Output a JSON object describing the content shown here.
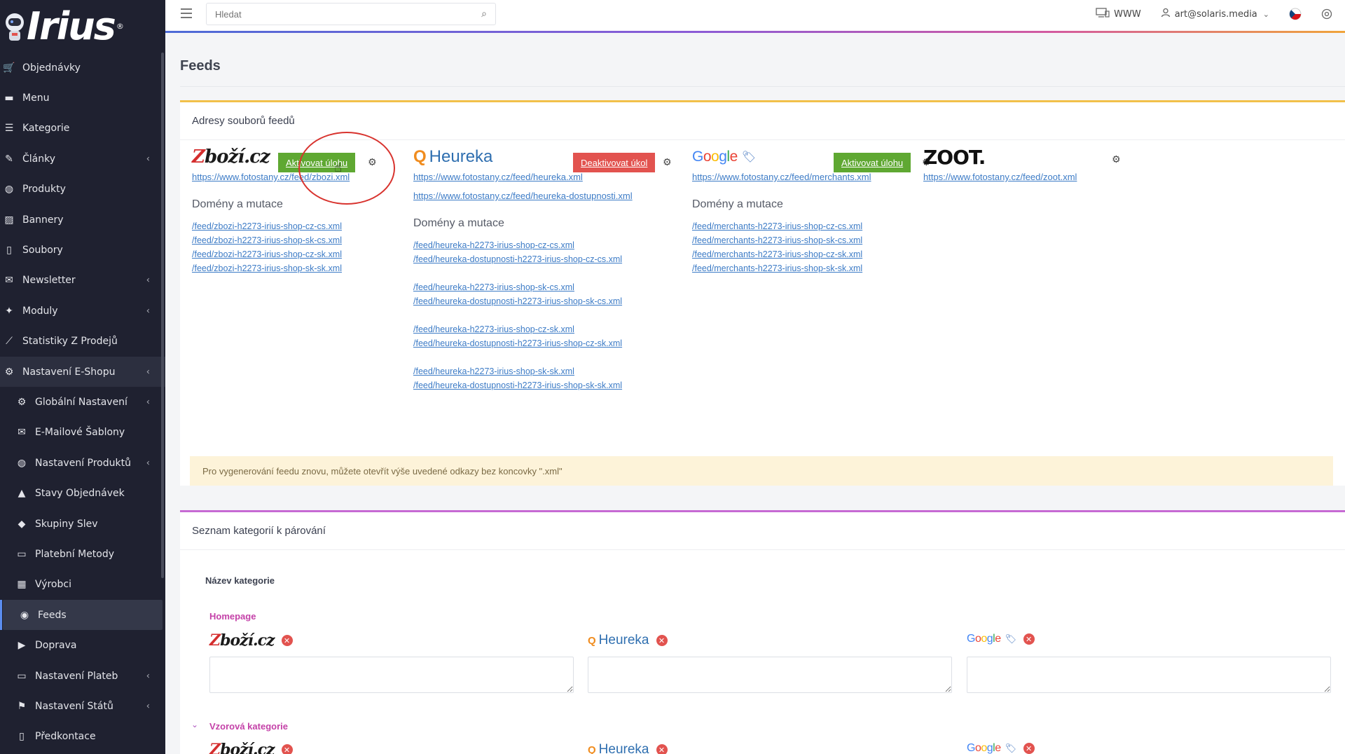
{
  "app": {
    "logo_text": "Irius",
    "logo_reg": "®"
  },
  "sidebar": {
    "items": [
      {
        "label": "Objednávky",
        "icon": "cart-icon",
        "chevron": ""
      },
      {
        "label": "Menu",
        "icon": "folder-icon",
        "chevron": ""
      },
      {
        "label": "Kategorie",
        "icon": "list-icon",
        "chevron": ""
      },
      {
        "label": "Články",
        "icon": "pencil-icon",
        "chevron": "‹"
      },
      {
        "label": "Produkty",
        "icon": "dribbble-icon",
        "chevron": ""
      },
      {
        "label": "Bannery",
        "icon": "image-icon",
        "chevron": ""
      },
      {
        "label": "Soubory",
        "icon": "file-icon",
        "chevron": ""
      },
      {
        "label": "Newsletter",
        "icon": "mail-icon",
        "chevron": "‹"
      },
      {
        "label": "Moduly",
        "icon": "puzzle-icon",
        "chevron": "‹"
      },
      {
        "label": "Statistiky Z Prodejů",
        "icon": "chart-icon",
        "chevron": ""
      },
      {
        "label": "Nastavení E-Shopu",
        "icon": "cogs-icon",
        "chevron": "‹"
      }
    ],
    "sub_items": [
      {
        "label": "Globální Nastavení",
        "icon": "gear-icon",
        "chevron": "‹"
      },
      {
        "label": "E-Mailové Šablony",
        "icon": "envelope-icon",
        "chevron": ""
      },
      {
        "label": "Nastavení Produktů",
        "icon": "dribbble-icon",
        "chevron": "‹"
      },
      {
        "label": "Stavy Objednávek",
        "icon": "bell-icon",
        "chevron": ""
      },
      {
        "label": "Skupiny Slev",
        "icon": "tag-icon",
        "chevron": ""
      },
      {
        "label": "Platební Metody",
        "icon": "credit-card-icon",
        "chevron": ""
      },
      {
        "label": "Výrobci",
        "icon": "building-icon",
        "chevron": ""
      },
      {
        "label": "Feeds",
        "icon": "rss-icon",
        "chevron": ""
      },
      {
        "label": "Doprava",
        "icon": "truck-icon",
        "chevron": ""
      },
      {
        "label": "Nastavení Plateb",
        "icon": "card-icon",
        "chevron": "‹"
      },
      {
        "label": "Nastavení Států",
        "icon": "flag-icon",
        "chevron": "‹"
      },
      {
        "label": "Předkontace",
        "icon": "document-icon",
        "chevron": ""
      }
    ]
  },
  "topbar": {
    "search_placeholder": "Hledat",
    "www_label": "WWW",
    "user_email": "art@solaris.media"
  },
  "page": {
    "title": "Feeds"
  },
  "feeds_card": {
    "title": "Adresy souborů feedů",
    "zbozi": {
      "logo": "Zboží.cz",
      "button": "Aktivovat úlohu",
      "url": "https://www.fotostany.cz/feed/zbozi.xml",
      "domains_heading": "Domény a mutace",
      "links": [
        "/feed/zbozi-h2273-irius-shop-cz-cs.xml",
        "/feed/zbozi-h2273-irius-shop-sk-cs.xml",
        "/feed/zbozi-h2273-irius-shop-cz-sk.xml",
        "/feed/zbozi-h2273-irius-shop-sk-sk.xml"
      ]
    },
    "heureka": {
      "logo": "Heureka",
      "button": "Deaktivovat úkol",
      "urls": [
        "https://www.fotostany.cz/feed/heureka.xml",
        "https://www.fotostany.cz/feed/heureka-dostupnosti.xml"
      ],
      "domains_heading": "Domény a mutace",
      "groups": [
        [
          "/feed/heureka-h2273-irius-shop-cz-cs.xml",
          "/feed/heureka-dostupnosti-h2273-irius-shop-cz-cs.xml"
        ],
        [
          "/feed/heureka-h2273-irius-shop-sk-cs.xml",
          "/feed/heureka-dostupnosti-h2273-irius-shop-sk-cs.xml"
        ],
        [
          "/feed/heureka-h2273-irius-shop-cz-sk.xml",
          "/feed/heureka-dostupnosti-h2273-irius-shop-cz-sk.xml"
        ],
        [
          "/feed/heureka-h2273-irius-shop-sk-sk.xml",
          "/feed/heureka-dostupnosti-h2273-irius-shop-sk-sk.xml"
        ]
      ]
    },
    "google": {
      "logo": "Google",
      "button": "Aktivovat úlohu",
      "url": "https://www.fotostany.cz/feed/merchants.xml",
      "domains_heading": "Domény a mutace",
      "links": [
        "/feed/merchants-h2273-irius-shop-cz-cs.xml",
        "/feed/merchants-h2273-irius-shop-sk-cs.xml",
        "/feed/merchants-h2273-irius-shop-cz-sk.xml",
        "/feed/merchants-h2273-irius-shop-sk-sk.xml"
      ]
    },
    "zoot": {
      "logo": "ZOOT.",
      "url": "https://www.fotostany.cz/feed/zoot.xml"
    },
    "notice": "Pro vygenerování feedu znovu, můžete otevřít výše uvedené odkazy bez koncovky \".xml\""
  },
  "categories_card": {
    "title": "Seznam kategorií k párování",
    "column_header": "Název kategorie",
    "categories": [
      {
        "name": "Homepage"
      },
      {
        "name": "Vzorová kategorie"
      }
    ],
    "logos": {
      "zbozi": "Zboží.cz",
      "heureka": "Heureka",
      "google": "Google"
    }
  },
  "colors": {
    "sidebar_bg": "#1f2130",
    "accent_green": "#5fa832",
    "accent_red": "#e2534f",
    "link": "#3c7bc6",
    "category_pink": "#c441a8"
  }
}
